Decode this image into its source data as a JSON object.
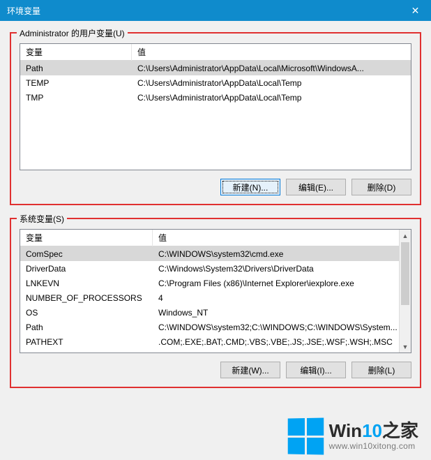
{
  "window": {
    "title": "环境变量",
    "close_glyph": "✕"
  },
  "user_section": {
    "label": "Administrator 的用户变量(U)",
    "headers": {
      "name": "变量",
      "value": "值"
    },
    "rows": [
      {
        "name": "Path",
        "value": "C:\\Users\\Administrator\\AppData\\Local\\Microsoft\\WindowsA...",
        "selected": true
      },
      {
        "name": "TEMP",
        "value": "C:\\Users\\Administrator\\AppData\\Local\\Temp",
        "selected": false
      },
      {
        "name": "TMP",
        "value": "C:\\Users\\Administrator\\AppData\\Local\\Temp",
        "selected": false
      }
    ],
    "buttons": {
      "new": "新建(N)...",
      "edit": "编辑(E)...",
      "delete": "删除(D)"
    }
  },
  "system_section": {
    "label": "系统变量(S)",
    "headers": {
      "name": "变量",
      "value": "值"
    },
    "rows": [
      {
        "name": "ComSpec",
        "value": "C:\\WINDOWS\\system32\\cmd.exe",
        "selected": true
      },
      {
        "name": "DriverData",
        "value": "C:\\Windows\\System32\\Drivers\\DriverData",
        "selected": false
      },
      {
        "name": "LNKEVN",
        "value": "C:\\Program Files (x86)\\Internet Explorer\\iexplore.exe",
        "selected": false
      },
      {
        "name": "NUMBER_OF_PROCESSORS",
        "value": "4",
        "selected": false
      },
      {
        "name": "OS",
        "value": "Windows_NT",
        "selected": false
      },
      {
        "name": "Path",
        "value": "C:\\WINDOWS\\system32;C:\\WINDOWS;C:\\WINDOWS\\System...",
        "selected": false
      },
      {
        "name": "PATHEXT",
        "value": ".COM;.EXE;.BAT;.CMD;.VBS;.VBE;.JS;.JSE;.WSF;.WSH;.MSC",
        "selected": false
      }
    ],
    "buttons": {
      "new": "新建(W)...",
      "edit": "编辑(I)...",
      "delete": "删除(L)"
    }
  },
  "watermark": {
    "brand_prefix": "Win",
    "brand_accent": "10",
    "brand_suffix": "之家",
    "url": "www.win10xitong.com"
  }
}
